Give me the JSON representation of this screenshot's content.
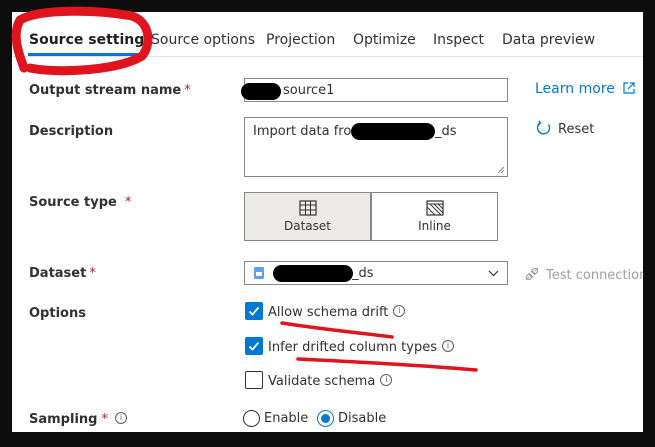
{
  "tabs": [
    {
      "label": "Source settings",
      "active": true
    },
    {
      "label": "Source options"
    },
    {
      "label": "Projection"
    },
    {
      "label": "Optimize"
    },
    {
      "label": "Inspect"
    },
    {
      "label": "Data preview"
    }
  ],
  "output_stream": {
    "label": "Output stream name",
    "required_mark": "*",
    "value": "source1"
  },
  "learn_more": "Learn more",
  "description": {
    "label": "Description",
    "value_start": "Import data from",
    "value_end": "_ds"
  },
  "reset": "Reset",
  "source_type": {
    "label": "Source type",
    "required_mark": "*",
    "options": [
      "Dataset",
      "Inline"
    ],
    "selected": "Dataset"
  },
  "dataset": {
    "label": "Dataset",
    "required_mark": "*",
    "value_suffix": "_ds"
  },
  "test_connection": "Test connection",
  "options": {
    "label": "Options",
    "items": [
      {
        "label": "Allow schema drift",
        "checked": true
      },
      {
        "label": "Infer drifted column types",
        "checked": true
      },
      {
        "label": "Validate schema",
        "checked": false
      }
    ]
  },
  "sampling": {
    "label": "Sampling",
    "required_mark": "*",
    "options": [
      "Enable",
      "Disable"
    ],
    "selected": "Disable"
  },
  "info_glyph": "i",
  "colors": {
    "accent": "#0078d4",
    "annotation": "#e0141e",
    "required": "#a4262c"
  },
  "icons": [
    "table-icon",
    "inline-hatch-icon",
    "external-link-icon",
    "reset-icon",
    "plug-icon",
    "chevron-down-icon",
    "dataset-icon",
    "info-icon"
  ]
}
